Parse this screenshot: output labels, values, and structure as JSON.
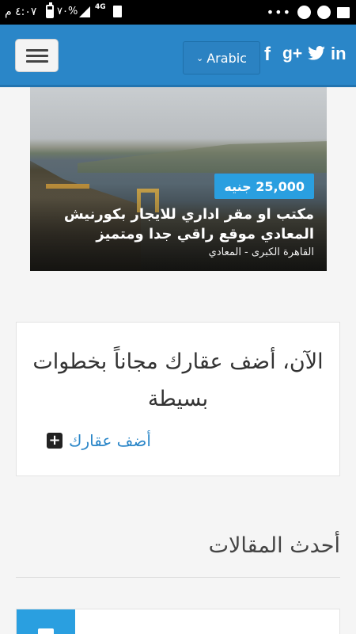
{
  "status_bar": {
    "time": "٤:٠٧ م",
    "battery": "٧٠%",
    "network": "4G",
    "icons": [
      "sim-icon",
      "signal-icon",
      "image-icon",
      "telegram-icon",
      "whatsapp-icon",
      "more-dots-icon"
    ]
  },
  "header": {
    "language_label": "Arabic",
    "social": {
      "facebook": "f",
      "google_plus": "g+",
      "twitter": "twitter-bird-icon",
      "linkedin": "in"
    },
    "colors": {
      "bar": "#2a86c8"
    }
  },
  "listing": {
    "price": "25,000 جنيه",
    "title": "مكتب او مقر اداري للايجار بكورنيش المعادي موقع راقي جدا ومتميز",
    "location": "القاهرة الكبرى - المعادي"
  },
  "add_property": {
    "heading": "الآن، أضف عقارك مجاناً بخطوات بسيطة",
    "link_label": "أضف عقارك"
  },
  "articles": {
    "heading": "أحدث المقالات"
  },
  "colors": {
    "accent": "#2a9fe0",
    "link": "#2a86c8"
  }
}
